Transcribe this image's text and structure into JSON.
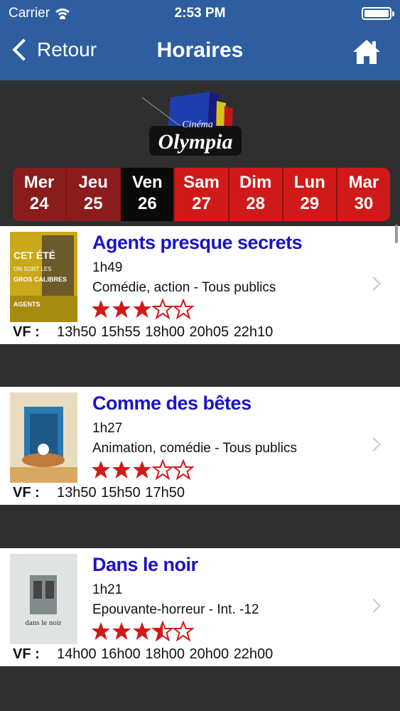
{
  "status": {
    "carrier": "Carrier",
    "time": "2:53 PM"
  },
  "nav": {
    "back_label": "Retour",
    "title": "Horaires"
  },
  "logo": {
    "text_small": "Cinéma",
    "text_big": "Olympia"
  },
  "days": [
    {
      "name": "Mer",
      "num": "24",
      "state": "past"
    },
    {
      "name": "Jeu",
      "num": "25",
      "state": "past"
    },
    {
      "name": "Ven",
      "num": "26",
      "state": "current"
    },
    {
      "name": "Sam",
      "num": "27",
      "state": "future"
    },
    {
      "name": "Dim",
      "num": "28",
      "state": "future"
    },
    {
      "name": "Lun",
      "num": "29",
      "state": "future"
    },
    {
      "name": "Mar",
      "num": "30",
      "state": "future"
    }
  ],
  "movies": [
    {
      "title": "Agents presque secrets",
      "duration": "1h49",
      "genre": "Comédie, action - Tous publics",
      "rating": 3,
      "version": "VF :",
      "times": "13h50 15h55 18h00 20h05 22h10"
    },
    {
      "title": "Comme des bêtes",
      "duration": "1h27",
      "genre": "Animation, comédie - Tous publics",
      "rating": 3,
      "version": "VF :",
      "times": "13h50 15h50 17h50"
    },
    {
      "title": "Dans le noir",
      "duration": "1h21",
      "genre": "Epouvante-horreur - Int. -12",
      "rating": 3.5,
      "version": "VF :",
      "times": "14h00 16h00 18h00 20h00 22h00"
    }
  ],
  "colors": {
    "nav": "#2f5ea0",
    "title": "#1a14c8",
    "star": "#d01a1a"
  }
}
